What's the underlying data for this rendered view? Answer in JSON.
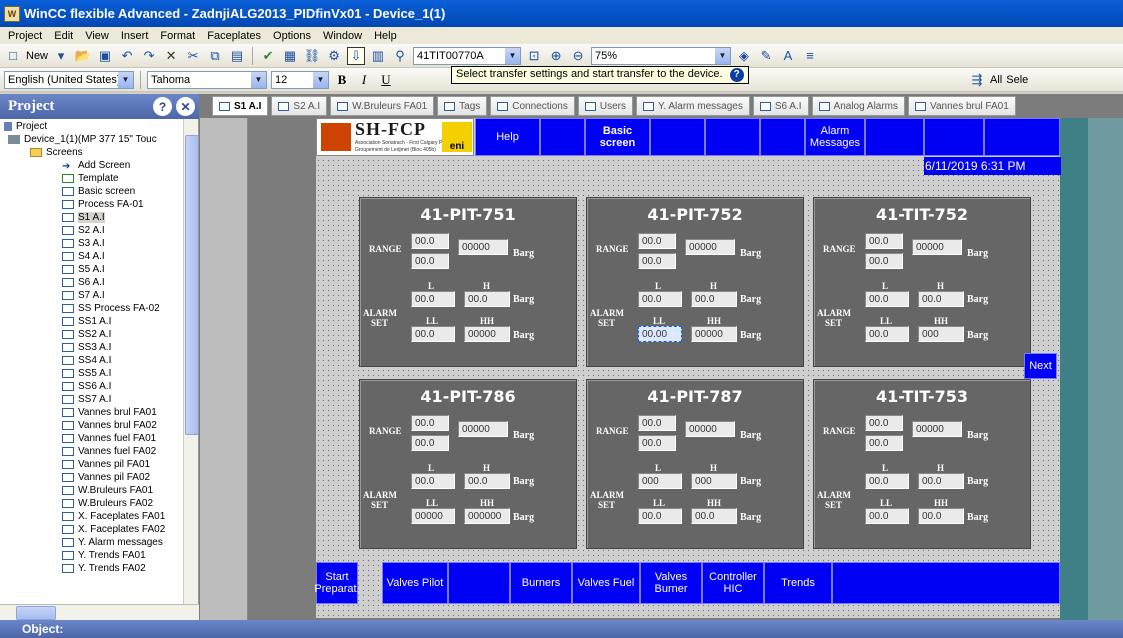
{
  "window": {
    "title": "WinCC flexible Advanced - ZadnjiALG2013_PIDfinVx01 - Device_1(1)"
  },
  "menu": [
    "Project",
    "Edit",
    "View",
    "Insert",
    "Format",
    "Faceplates",
    "Options",
    "Window",
    "Help"
  ],
  "toolbar1": {
    "new_label": "New",
    "tag_combo": "41TIT00770A",
    "zoom_combo": "75%"
  },
  "toolbar2": {
    "language": "English (United States)",
    "font": "Tahoma",
    "font_size": "12",
    "bold": "B",
    "italic": "I",
    "underline": "U",
    "all_label": "All",
    "select_label": "Sele"
  },
  "tooltip": "Select transfer settings and start transfer to the device.",
  "project_panel": {
    "title": "Project",
    "items": [
      "Project",
      "Device_1(1)(MP 377 15\" Touc",
      "Screens",
      "Add Screen",
      "Template",
      "Basic screen",
      "Process FA-01",
      "S1 A.I",
      "S2 A.I",
      "S3 A.I",
      "S4 A.I",
      "S5 A.I",
      "S6 A.I",
      "S7 A.I",
      "SS Process FA-02",
      "SS1 A.I",
      "SS2 A.I",
      "SS3 A.I",
      "SS4 A.I",
      "SS5 A.I",
      "SS6 A.I",
      "SS7 A.I",
      "Vannes brul FA01",
      "Vannes brul FA02",
      "Vannes fuel FA01",
      "Vannes fuel FA02",
      "Vannes pil FA01",
      "Vannes pil FA02",
      "W.Bruleurs FA01",
      "W.Bruleurs FA02",
      "X. Faceplates FA01",
      "X. Faceplates FA02",
      "Y. Alarm messages",
      "Y. Trends FA01",
      "Y. Trends FA02"
    ]
  },
  "object_bar": "Object:",
  "tabs": [
    "S1 A.I",
    "S2 A.I",
    "W.Bruleurs FA01",
    "Tags",
    "Connections",
    "Users",
    "Y. Alarm messages",
    "S6 A.I",
    "Analog Alarms",
    "Vannes brul FA01"
  ],
  "screen": {
    "logo_text": "SH-FCP",
    "logo_sub1": "Association Sonatrach - First Calgary Petroleums",
    "logo_sub2": "Groupement de Ledjmet (Bloc 405b)",
    "logo_eni": "eni",
    "header": [
      "Help",
      "Basic screen",
      "Alarm Messages"
    ],
    "datetime": "6/11/2019 6:31 PM",
    "next": "Next",
    "labels": {
      "range": "RANGE",
      "alarm": "ALARM",
      "set": "SET",
      "l": "L",
      "h": "H",
      "ll": "LL",
      "hh": "HH",
      "unit": "Barg"
    },
    "panels": [
      {
        "title": "41-PIT-751",
        "range_hi": "00.0",
        "range_lo": "00.0",
        "value": "00000",
        "l": "00.0",
        "h": "00.0",
        "ll": "00.0",
        "hh": "00000"
      },
      {
        "title": "41-PIT-752",
        "range_hi": "00.0",
        "range_lo": "00.0",
        "value": "00000",
        "l": "00.0",
        "h": "00.0",
        "ll": "00.00",
        "hh": "00000"
      },
      {
        "title": "41-TIT-752",
        "range_hi": "00.0",
        "range_lo": "00.0",
        "value": "00000",
        "l": "00.0",
        "h": "00.0",
        "ll": "00.0",
        "hh": "000"
      },
      {
        "title": "41-PIT-786",
        "range_hi": "00.0",
        "range_lo": "00.0",
        "value": "00000",
        "l": "00.0",
        "h": "00.0",
        "ll": "00000",
        "hh": "000000"
      },
      {
        "title": "41-PIT-787",
        "range_hi": "00.0",
        "range_lo": "00.0",
        "value": "00000",
        "l": "000",
        "h": "000",
        "ll": "00.0",
        "hh": "00.0"
      },
      {
        "title": "41-TIT-753",
        "range_hi": "00.0",
        "range_lo": "00.0",
        "value": "00000",
        "l": "00.0",
        "h": "00.0",
        "ll": "00.0",
        "hh": "00.0"
      }
    ],
    "bottom": [
      "Start Preparat.",
      "Valves Pilot",
      "Burners",
      "Valves Fuel",
      "Valves Burner",
      "Controller HIC",
      "Trends"
    ]
  },
  "colors": {
    "hmi_blue": "#0000f5",
    "panel_grey": "#666666",
    "title_blue": "#0a5fd8"
  }
}
